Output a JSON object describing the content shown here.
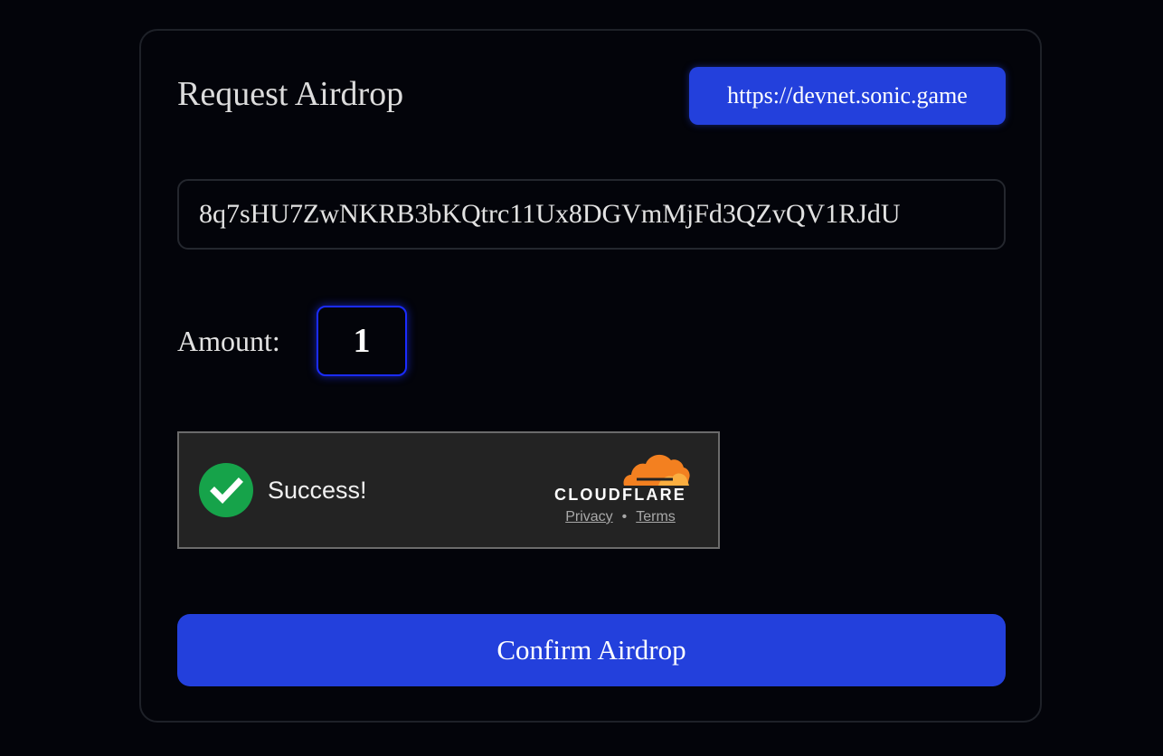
{
  "header": {
    "title": "Request Airdrop",
    "network_label": "https://devnet.sonic.game"
  },
  "form": {
    "address_value": "8q7sHU7ZwNKRB3bKQtrc11Ux8DGVmMjFd3QZvQV1RJdU",
    "amount_label": "Amount:",
    "amount_value": "1"
  },
  "captcha": {
    "status_text": "Success!",
    "brand": "CLOUDFLARE",
    "privacy_label": "Privacy",
    "separator": "•",
    "terms_label": "Terms",
    "check_color": "#16a34a",
    "brand_orange": "#f38020"
  },
  "actions": {
    "confirm_label": "Confirm Airdrop"
  },
  "colors": {
    "accent": "#2340dc",
    "background": "#03040a"
  }
}
